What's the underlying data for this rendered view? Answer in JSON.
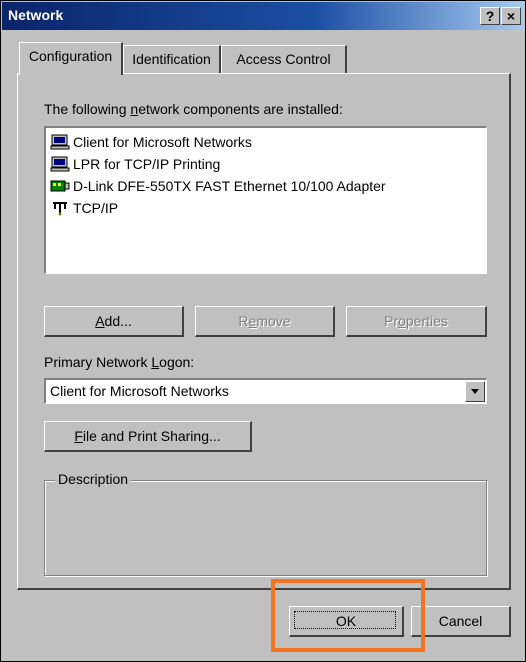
{
  "window": {
    "title": "Network",
    "help_glyph": "?",
    "close_glyph": "×"
  },
  "tabs": [
    {
      "label": "Configuration"
    },
    {
      "label": "Identification"
    },
    {
      "label": "Access Control"
    }
  ],
  "components": {
    "label_pre": "The following ",
    "label_accel": "n",
    "label_post": "etwork components are installed:",
    "items": [
      {
        "label": "Client for Microsoft Networks",
        "icon": "network-client-icon"
      },
      {
        "label": "LPR for TCP/IP Printing",
        "icon": "network-client-icon"
      },
      {
        "label": "D-Link DFE-550TX FAST Ethernet 10/100 Adapter",
        "icon": "network-adapter-icon"
      },
      {
        "label": "TCP/IP",
        "icon": "protocol-icon"
      }
    ]
  },
  "buttons": {
    "add_accel": "A",
    "add_rest": "dd...",
    "remove_pre": "R",
    "remove_accel": "e",
    "remove_post": "move",
    "properties_pre": "Pr",
    "properties_accel": "o",
    "properties_post": "perties",
    "file_accel": "F",
    "file_rest": "ile and Print Sharing...",
    "ok": "OK",
    "cancel": "Cancel"
  },
  "logon": {
    "label_pre": "Primary Network ",
    "label_accel": "L",
    "label_post": "ogon:",
    "value": "Client for Microsoft Networks"
  },
  "description": {
    "label": "Description"
  },
  "colors": {
    "highlight": "#f47321",
    "titlebar": "#0a246a"
  }
}
